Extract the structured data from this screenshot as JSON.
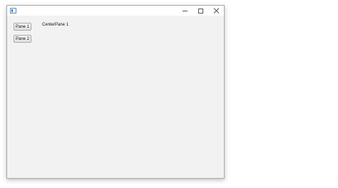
{
  "titlebar": {
    "icon": "java-app-icon",
    "controls": [
      "minimize-icon",
      "maximize-icon",
      "close-icon"
    ]
  },
  "sidebar": {
    "buttons": [
      {
        "label": "Pane 1"
      },
      {
        "label": "Pane 2"
      }
    ]
  },
  "center": {
    "label": "CenterPane 1"
  }
}
